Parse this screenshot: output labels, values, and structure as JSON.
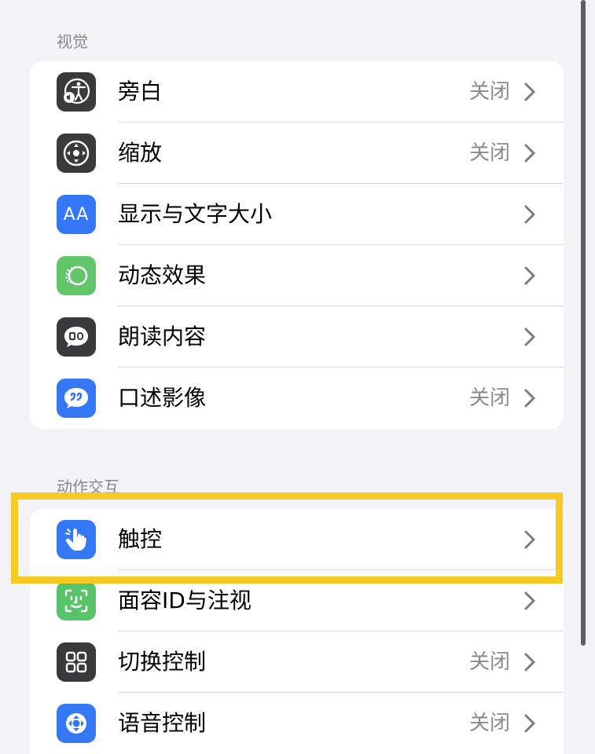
{
  "sections": {
    "vision": {
      "header": "视觉",
      "rows": [
        {
          "label": "旁白",
          "value": "关闭",
          "icon": "voiceover-icon",
          "icon_bg": "#3a3a3c"
        },
        {
          "label": "缩放",
          "value": "关闭",
          "icon": "zoom-icon",
          "icon_bg": "#3a3a3c"
        },
        {
          "label": "显示与文字大小",
          "value": "",
          "icon": "text-size-icon",
          "icon_bg": "#3478f6"
        },
        {
          "label": "动态效果",
          "value": "",
          "icon": "motion-icon",
          "icon_bg": "#62c569"
        },
        {
          "label": "朗读内容",
          "value": "",
          "icon": "spoken-content-icon",
          "icon_bg": "#3a3a3c"
        },
        {
          "label": "口述影像",
          "value": "关闭",
          "icon": "audio-description-icon",
          "icon_bg": "#3478f6"
        }
      ]
    },
    "interaction": {
      "header": "动作交互",
      "rows": [
        {
          "label": "触控",
          "value": "",
          "icon": "touch-hand-icon",
          "icon_bg": "#3478f6"
        },
        {
          "label": "面容ID与注视",
          "value": "",
          "icon": "face-id-icon",
          "icon_bg": "#57c46a"
        },
        {
          "label": "切换控制",
          "value": "关闭",
          "icon": "switch-control-icon",
          "icon_bg": "#3a3a3c"
        },
        {
          "label": "语音控制",
          "value": "关闭",
          "icon": "voice-control-icon",
          "icon_bg": "#3478f6"
        }
      ]
    }
  },
  "icons": {
    "aa_text": "AA"
  },
  "highlight_color": "#f7c923"
}
